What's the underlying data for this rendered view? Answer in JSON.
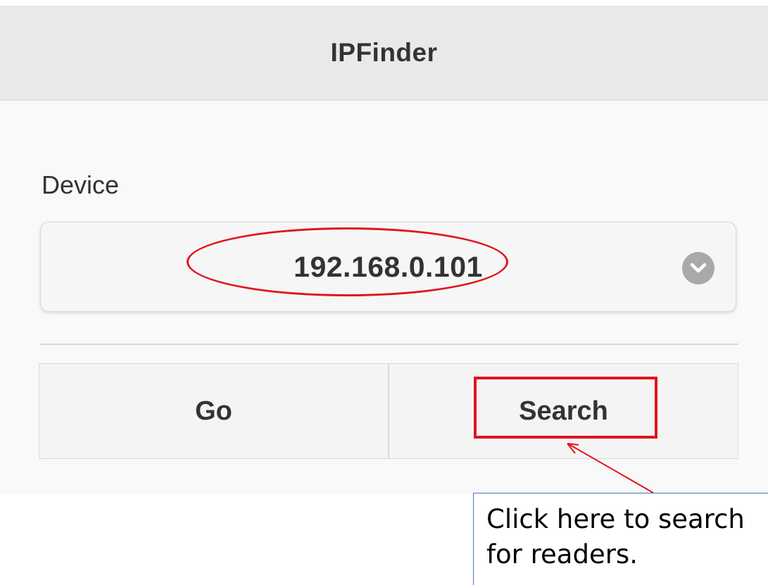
{
  "header": {
    "title": "IPFinder"
  },
  "device": {
    "label": "Device",
    "selected": "192.168.0.101",
    "dropdown_icon": "chevron-down-circle-icon"
  },
  "actions": {
    "go_label": "Go",
    "search_label": "Search"
  },
  "annotation": {
    "line1": "Click here to search",
    "line2": "for readers.",
    "highlight_color": "#e0141e",
    "callout_border_color": "#4472c4"
  }
}
